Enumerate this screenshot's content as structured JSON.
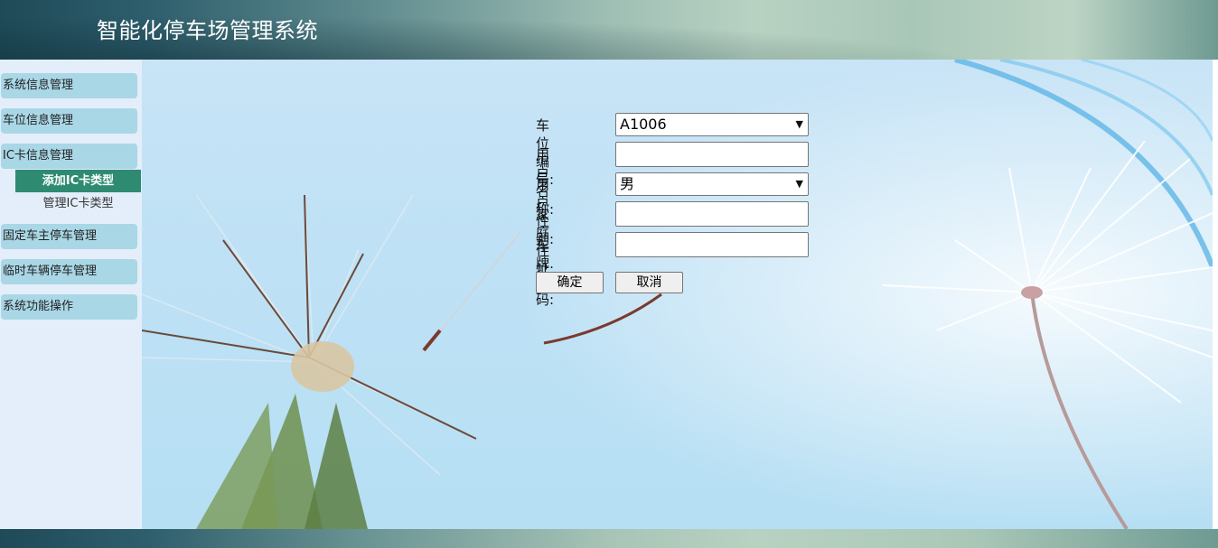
{
  "header": {
    "title": "智能化停车场管理系统"
  },
  "sidebar": {
    "items": [
      {
        "label": "系统信息管理"
      },
      {
        "label": "车位信息管理"
      },
      {
        "label": "IC卡信息管理"
      },
      {
        "label": "固定车主停车管理"
      },
      {
        "label": "临时车辆停车管理"
      },
      {
        "label": "系统功能操作"
      }
    ],
    "sub_items": [
      {
        "label": "添加IC卡类型",
        "active": true
      },
      {
        "label": "管理IC卡类型",
        "active": false
      }
    ]
  },
  "form": {
    "space_no": {
      "label": "车位编号:",
      "value": "A1006"
    },
    "user_name": {
      "label": "用户名称:",
      "value": ""
    },
    "gender": {
      "label": "用户性别:",
      "value": "男"
    },
    "address": {
      "label": "家庭住址:",
      "value": ""
    },
    "plate": {
      "label": "车牌号码:",
      "value": ""
    },
    "confirm_label": "确定",
    "cancel_label": "取消"
  },
  "colors": {
    "sidebar_bg": "#e3eefa",
    "menu_item_bg": "#a9d7e6",
    "active_sub_bg": "#2e8b72"
  }
}
